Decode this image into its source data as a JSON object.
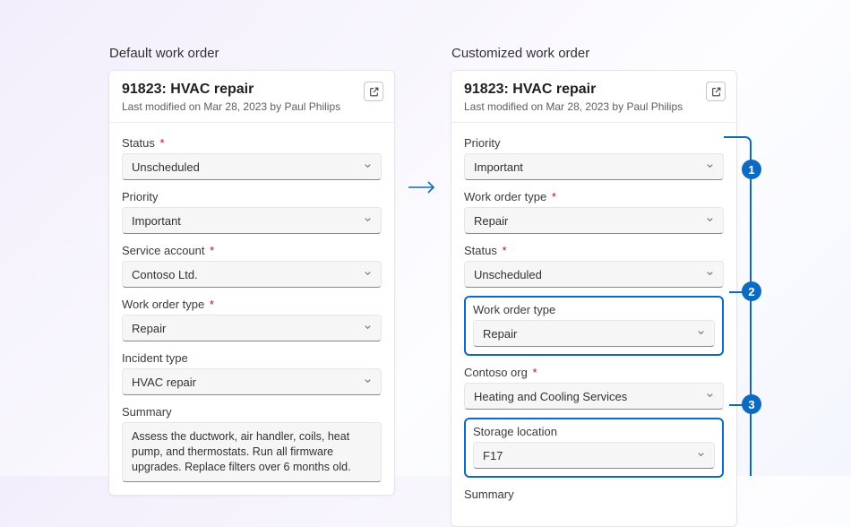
{
  "left": {
    "heading": "Default work order",
    "card": {
      "title": "91823: HVAC repair",
      "subtitle": "Last modified on Mar 28, 2023 by Paul Philips",
      "fields": [
        {
          "label": "Status",
          "required": true,
          "value": "Unscheduled"
        },
        {
          "label": "Priority",
          "required": false,
          "value": "Important"
        },
        {
          "label": "Service account",
          "required": true,
          "value": "Contoso Ltd."
        },
        {
          "label": "Work order type",
          "required": true,
          "value": "Repair"
        },
        {
          "label": "Incident type",
          "required": false,
          "value": "HVAC repair"
        }
      ],
      "summary_label": "Summary",
      "summary_value": "Assess the ductwork, air handler, coils, heat pump, and thermostats. Run all firmware upgrades. Replace filters over 6 months old."
    }
  },
  "right": {
    "heading": "Customized work order",
    "card": {
      "title": "91823: HVAC repair",
      "subtitle": "Last modified on Mar 28, 2023 by Paul Philips",
      "fields": [
        {
          "label": "Priority",
          "required": false,
          "value": "Important",
          "highlight": false
        },
        {
          "label": "Work order type",
          "required": true,
          "value": "Repair",
          "highlight": false
        },
        {
          "label": "Status",
          "required": true,
          "value": "Unscheduled",
          "highlight": false
        },
        {
          "label": "Work order type",
          "required": false,
          "value": "Repair",
          "highlight": true
        },
        {
          "label": "Contoso org",
          "required": true,
          "value": "Heating and Cooling Services",
          "highlight": false
        },
        {
          "label": "Storage location",
          "required": false,
          "value": "F17",
          "highlight": true
        }
      ],
      "summary_label": "Summary"
    }
  },
  "callouts": {
    "c1": "1",
    "c2": "2",
    "c3": "3"
  }
}
